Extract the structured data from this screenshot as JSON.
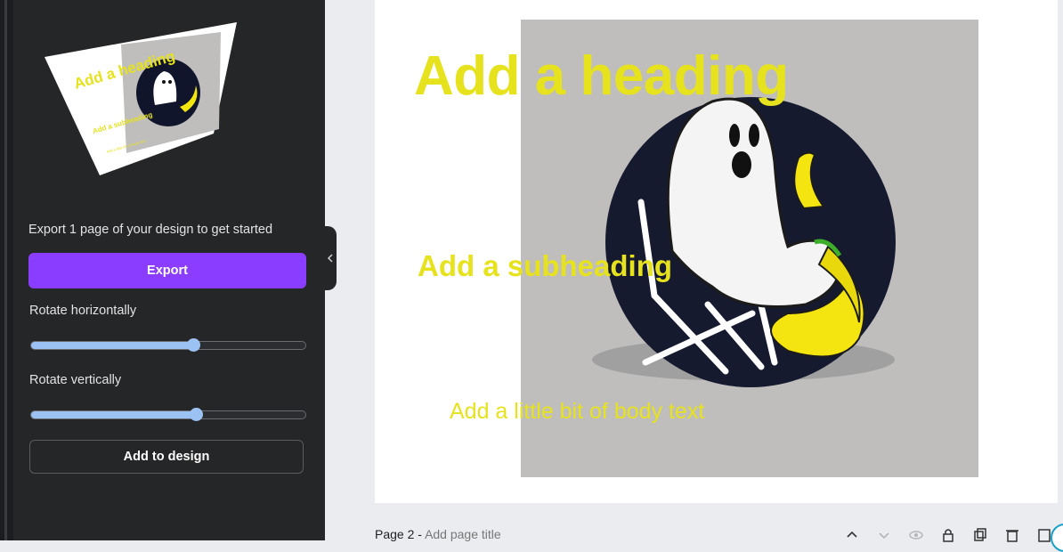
{
  "panel": {
    "message": "Export 1 page of your design to get started",
    "export_label": "Export",
    "rotate_horizontal_label": "Rotate horizontally",
    "rotate_horizontal_value": 0.59,
    "rotate_vertical_label": "Rotate vertically",
    "rotate_vertical_value": 0.6,
    "add_to_design_label": "Add to design",
    "preview": {
      "heading": "Add a heading",
      "subheading": "Add a subheading",
      "body": "Add a little bit of body text"
    }
  },
  "canvas": {
    "heading": "Add a heading",
    "subheading": "Add a subheading",
    "body": "Add a little bit of body text",
    "text_color": "#e6e21e",
    "accent_color": "#8b3dff"
  },
  "footer": {
    "page_label": "Page 2 -",
    "page_title_placeholder": "Add page title"
  },
  "icons": [
    "chevron-left-icon",
    "chevron-up-icon",
    "chevron-down-icon",
    "eye-icon",
    "lock-icon",
    "duplicate-icon",
    "trash-icon",
    "add-page-icon"
  ]
}
